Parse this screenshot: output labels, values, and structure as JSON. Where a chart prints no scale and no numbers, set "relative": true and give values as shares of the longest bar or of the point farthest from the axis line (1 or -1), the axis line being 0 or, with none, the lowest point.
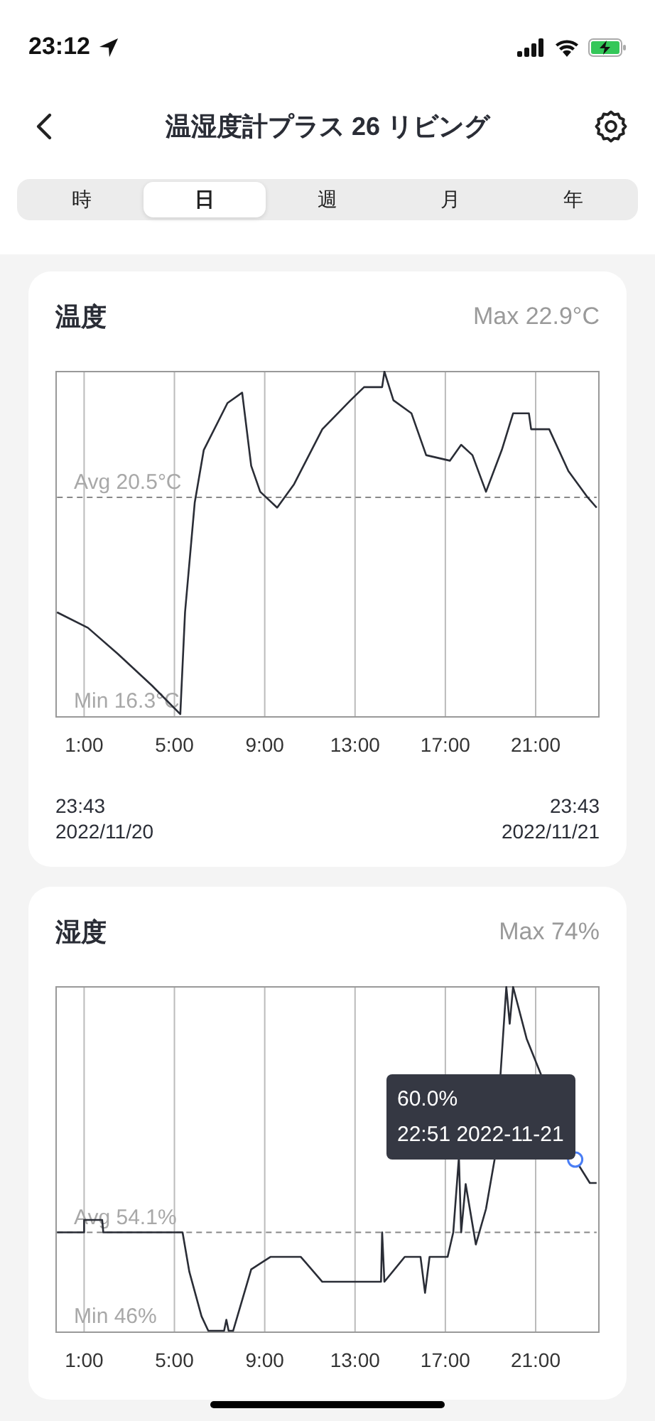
{
  "status_bar": {
    "time": "23:12"
  },
  "header": {
    "title": "温湿度計プラス 26 リビング"
  },
  "tabs": [
    {
      "label": "時",
      "selected": false
    },
    {
      "label": "日",
      "selected": true
    },
    {
      "label": "週",
      "selected": false
    },
    {
      "label": "月",
      "selected": false
    },
    {
      "label": "年",
      "selected": false
    }
  ],
  "cards": [
    {
      "title": "温度",
      "max": "Max 22.9°C",
      "chart_data": {
        "type": "line",
        "grid": true,
        "relative": true,
        "xlim": [
          -0.24,
          23.8
        ],
        "xticks": [
          {
            "value": 1,
            "label": "1:00"
          },
          {
            "value": 5,
            "label": "5:00"
          },
          {
            "value": 9,
            "label": "9:00"
          },
          {
            "value": 13,
            "label": "13:00"
          },
          {
            "value": 17,
            "label": "17:00"
          },
          {
            "value": 21,
            "label": "21:00"
          }
        ],
        "annotations": [
          "Min 16.3°C"
        ],
        "x": [
          -0.2,
          1.17,
          2.5,
          4.0,
          5.26,
          5.47,
          5.9,
          6.3,
          7.35,
          8.0,
          8.4,
          8.8,
          9.55,
          10.3,
          11.55,
          12.8,
          13.4,
          14.2,
          14.3,
          14.7,
          15.5,
          16.15,
          17.2,
          17.7,
          18.2,
          18.8,
          19.5,
          20.0,
          20.7,
          20.8,
          21.6,
          22.45,
          23.3,
          23.7
        ],
        "series": [
          {
            "color": "#2a2d36",
            "values": [
              0.303,
              0.258,
              0.182,
              0.091,
              0.008,
              0.303,
              0.621,
              0.773,
              0.909,
              0.939,
              0.727,
              0.652,
              0.606,
              0.674,
              0.833,
              0.917,
              0.955,
              0.955,
              1,
              0.917,
              0.879,
              0.758,
              0.742,
              0.788,
              0.758,
              0.652,
              0.773,
              0.879,
              0.879,
              0.833,
              0.833,
              0.712,
              0.636,
              0.606
            ]
          },
          {
            "name": "Avg 20.5°C",
            "color": "#888888",
            "line_style": "dashed",
            "values": [
              0.636,
              0.636,
              0.636,
              0.636,
              0.636,
              0.636,
              0.636,
              0.636,
              0.636,
              0.636,
              0.636,
              0.636,
              0.636,
              0.636,
              0.636,
              0.636,
              0.636,
              0.636,
              0.636,
              0.636,
              0.636,
              0.636,
              0.636,
              0.636,
              0.636,
              0.636,
              0.636,
              0.636,
              0.636,
              0.636,
              0.636,
              0.636,
              0.636,
              0.636
            ]
          }
        ]
      },
      "range": {
        "start_time": "23:43",
        "start_date": "2022/11/20",
        "end_time": "23:43",
        "end_date": "2022/11/21"
      }
    },
    {
      "title": "湿度",
      "max": "Max 74%",
      "chart_data": {
        "type": "line",
        "grid": true,
        "relative": true,
        "xlim": [
          -0.24,
          23.8
        ],
        "xticks": [
          {
            "value": 1,
            "label": "1:00"
          },
          {
            "value": 5,
            "label": "5:00"
          },
          {
            "value": 9,
            "label": "9:00"
          },
          {
            "value": 13,
            "label": "13:00"
          },
          {
            "value": 17,
            "label": "17:00"
          },
          {
            "value": 21,
            "label": "21:00"
          }
        ],
        "annotations": [
          "Min 46%",
          {
            "x": 22.75,
            "y": 0.5,
            "text": "60.0%\n22:51 2022-11-21"
          }
        ],
        "x": [
          -0.2,
          1.0,
          1.0,
          1.8,
          1.85,
          5.36,
          5.66,
          6.2,
          6.5,
          7.2,
          7.3,
          7.4,
          7.6,
          8.4,
          9.25,
          10.6,
          11.55,
          14.15,
          14.2,
          14.3,
          15.2,
          15.9,
          16.1,
          16.3,
          17.1,
          17.35,
          17.6,
          17.7,
          17.9,
          18.35,
          18.8,
          19.2,
          19.7,
          19.85,
          20.0,
          20.6,
          22.75,
          23.4,
          23.7
        ],
        "series": [
          {
            "color": "#2a2d36",
            "values": [
              0.289,
              0.289,
              0.325,
              0.325,
              0.289,
              0.289,
              0.175,
              0.046,
              0.004,
              0.004,
              0.036,
              0.004,
              0.004,
              0.182,
              0.218,
              0.218,
              0.146,
              0.146,
              0.289,
              0.146,
              0.218,
              0.218,
              0.114,
              0.218,
              0.218,
              0.289,
              0.507,
              0.289,
              0.429,
              0.254,
              0.357,
              0.507,
              1,
              0.893,
              1,
              0.85,
              0.5,
              0.432,
              0.432
            ]
          },
          {
            "name": "Avg 54.1%",
            "color": "#888888",
            "line_style": "dashed",
            "values": [
              0.289,
              0.289,
              0.289,
              0.289,
              0.289,
              0.289,
              0.289,
              0.289,
              0.289,
              0.289,
              0.289,
              0.289,
              0.289,
              0.289,
              0.289,
              0.289,
              0.289,
              0.289,
              0.289,
              0.289,
              0.289,
              0.289,
              0.289,
              0.289,
              0.289,
              0.289,
              0.289,
              0.289,
              0.289,
              0.289,
              0.289,
              0.289,
              0.289,
              0.289,
              0.289,
              0.289,
              0.289,
              0.289,
              0.289
            ]
          }
        ]
      }
    }
  ]
}
